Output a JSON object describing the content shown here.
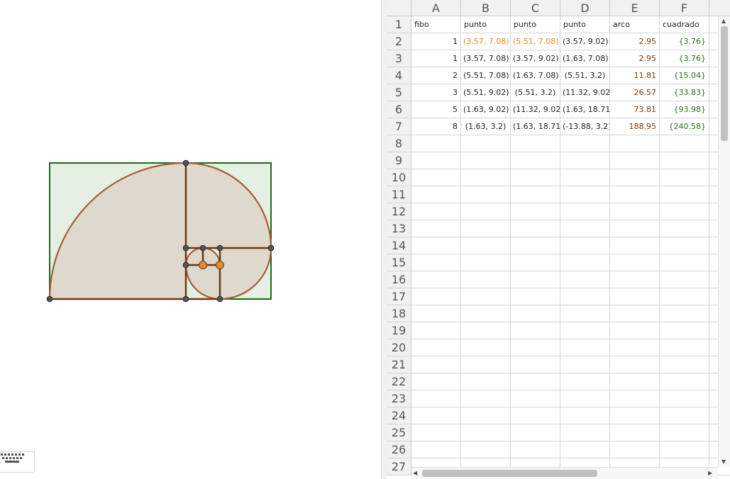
{
  "spreadsheet": {
    "columns": [
      "A",
      "B",
      "C",
      "D",
      "E",
      "F"
    ],
    "rows": [
      "1",
      "2",
      "3",
      "4",
      "5",
      "6",
      "7",
      "8",
      "9",
      "10",
      "11",
      "12",
      "13",
      "14",
      "15",
      "16",
      "17",
      "18",
      "19",
      "20",
      "21",
      "22",
      "23",
      "24",
      "25",
      "26",
      "27"
    ],
    "data": [
      [
        "fibo",
        "punto",
        "punto",
        "punto",
        "arco",
        "cuadrado"
      ],
      [
        "1",
        "(3.57, 7.08)",
        "(5.51, 7.08)",
        "(3.57, 9.02)",
        "2.95",
        "{3.76}"
      ],
      [
        "1",
        "(3.57, 7.08)",
        "(3.57, 9.02)",
        "(1.63, 7.08)",
        "2.95",
        "{3.76}"
      ],
      [
        "2",
        "(5.51, 7.08)",
        "(1.63, 7.08)",
        "(5.51, 3.2)",
        "11.81",
        "{15.04}"
      ],
      [
        "3",
        "(5.51, 9.02)",
        "(5.51, 3.2)",
        "(11.32, 9.02",
        "26.57",
        "{33.83}"
      ],
      [
        "5",
        "(1.63, 9.02)",
        "(11.32, 9.02",
        "(1.63, 18.71",
        "73.81",
        "{93.98}"
      ],
      [
        "8",
        "(1.63, 3.2)",
        "(1.63, 18.71",
        "(-13.88, 3.2)",
        "188.95",
        "{240.58}"
      ]
    ]
  },
  "colors": {
    "accent_orange": "#e8891c",
    "arc_brown": "#a0603c",
    "segment_brown": "#6b3a10",
    "rect_green": "#1a6b12",
    "rect_fill": "#e6efe3",
    "sector_fill": "#ded9cc",
    "value_brown": "#7a3a08",
    "list_green": "#2f6f1f"
  },
  "icons": {
    "keyboard": "keyboard-icon"
  }
}
